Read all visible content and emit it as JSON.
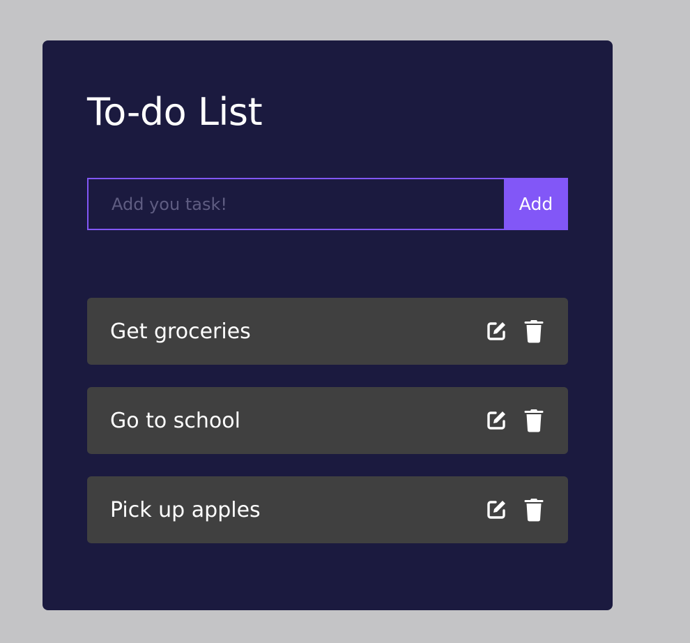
{
  "app": {
    "title": "To-do List"
  },
  "input": {
    "placeholder": "Add you task!",
    "value": ""
  },
  "buttons": {
    "add_label": "Add"
  },
  "tasks": [
    {
      "text": "Get groceries",
      "icons": [
        "edit-icon",
        "trash-icon"
      ]
    },
    {
      "text": "Go to school",
      "icons": [
        "edit-icon",
        "trash-icon"
      ]
    },
    {
      "text": "Pick up apples",
      "icons": [
        "edit-icon",
        "trash-icon"
      ]
    }
  ],
  "colors": {
    "page_background": "#c4c4c6",
    "card_background": "#1b1a3f",
    "accent": "#8257f7",
    "task_background": "#404040",
    "text": "#ffffff",
    "placeholder": "#5f5d82"
  }
}
